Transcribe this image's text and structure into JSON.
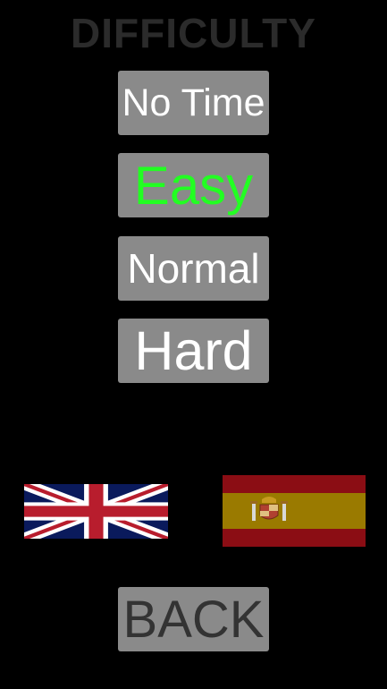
{
  "menu": {
    "title": "DIFFICULTY",
    "options": [
      {
        "label": "No Time",
        "selected": false
      },
      {
        "label": "Easy",
        "selected": true
      },
      {
        "label": "Normal",
        "selected": false
      },
      {
        "label": "Hard",
        "selected": false
      }
    ],
    "selected_color": "#22ff22",
    "back_label": "BACK"
  },
  "languages": [
    {
      "icon": "uk-flag-icon"
    },
    {
      "icon": "spain-flag-icon"
    }
  ],
  "colors": {
    "background": "#000000",
    "button": "#8a8a8a",
    "title": "#2b2b2b"
  }
}
